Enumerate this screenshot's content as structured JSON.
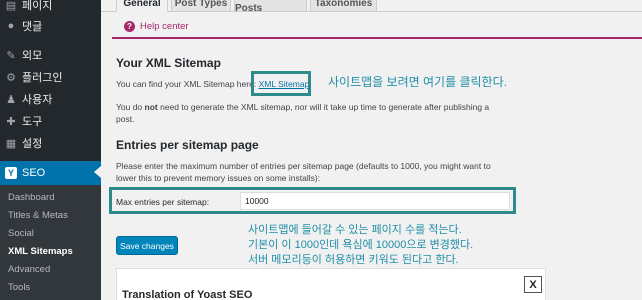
{
  "sidebar": {
    "items": [
      {
        "label": "페이지",
        "icon": "page-icon"
      },
      {
        "label": "댓글",
        "icon": "comment-icon"
      },
      {
        "label": "외모",
        "icon": "brush-icon"
      },
      {
        "label": "플러그인",
        "icon": "plugin-icon"
      },
      {
        "label": "사용자",
        "icon": "user-icon"
      },
      {
        "label": "도구",
        "icon": "wrench-icon"
      },
      {
        "label": "설정",
        "icon": "settings-icon"
      },
      {
        "label": "SEO",
        "icon": "yoast-icon"
      }
    ],
    "submenu": [
      "Dashboard",
      "Titles & Metas",
      "Social",
      "XML Sitemaps",
      "Advanced",
      "Tools"
    ]
  },
  "tabs": [
    "General",
    "Post Types",
    "Excluded Posts",
    "Taxonomies"
  ],
  "help_center": "Help center",
  "xml_section": {
    "title": "Your XML Sitemap",
    "text_before_link": "You can find your XML Sitemap here:",
    "link": "XML Sitemap",
    "note_line1_a": "You do ",
    "note_line1_bold": "not",
    "note_line1_b": " need to generate the XML sitemap, nor will it take up time to generate after publishing a",
    "note_line2": "post."
  },
  "entries_section": {
    "title": "Entries per sitemap page",
    "desc_line1": "Please enter the maximum number of entries per sitemap page (defaults to 1000, you might want to",
    "desc_line2": "lower this to prevent memory issues on some installs):",
    "field_label": "Max entries per sitemap:",
    "field_value": "10000"
  },
  "annotations": {
    "click_sitemap": "사이트맵을 보려면 여기를 클릭한다.",
    "entries_line1": "사이트맵에 들어갈 수 있는 페이지 수를 적는다.",
    "entries_line2": "기본이 이 1000인데 욕심에 10000으로 변경했다.",
    "entries_line3": "서버 메모리등이 허용하면 키워도 된다고 한다."
  },
  "save_button": "Save changes",
  "translation_box": {
    "title": "Translation of Yoast SEO",
    "close": "X"
  },
  "colors": {
    "sidebar_bg": "#23282d",
    "active_blue": "#0073aa",
    "help_accent": "#a4286a",
    "callout_border": "#2e8b8b",
    "annotation_text": "#1f8ea8"
  }
}
